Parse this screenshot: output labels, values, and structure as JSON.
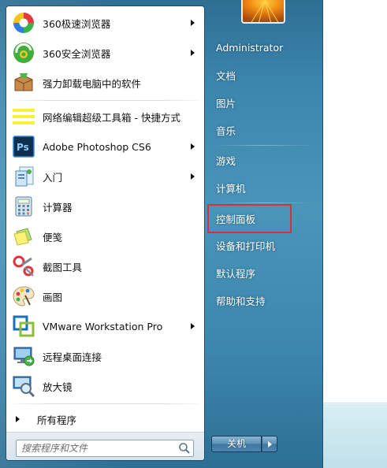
{
  "programs": [
    {
      "label": "360极速浏览器",
      "icon": "360-speed-browser-icon",
      "has_submenu": true
    },
    {
      "label": "360安全浏览器",
      "icon": "360-safe-browser-icon",
      "has_submenu": true
    },
    {
      "label": "强力卸载电脑中的软件",
      "icon": "uninstall-box-icon",
      "has_submenu": false
    },
    {
      "label": "网络编辑超级工具箱 - 快捷方式",
      "icon": "yellow-lines-icon",
      "has_submenu": false
    },
    {
      "label": "Adobe Photoshop CS6",
      "icon": "photoshop-icon",
      "has_submenu": true
    },
    {
      "label": "入门",
      "icon": "getting-started-icon",
      "has_submenu": true
    },
    {
      "label": "计算器",
      "icon": "calculator-icon",
      "has_submenu": false
    },
    {
      "label": "便笺",
      "icon": "sticky-notes-icon",
      "has_submenu": false
    },
    {
      "label": "截图工具",
      "icon": "snipping-tool-icon",
      "has_submenu": false
    },
    {
      "label": "画图",
      "icon": "paint-palette-icon",
      "has_submenu": false
    },
    {
      "label": "VMware Workstation Pro",
      "icon": "vmware-icon",
      "has_submenu": true
    },
    {
      "label": "远程桌面连接",
      "icon": "remote-desktop-icon",
      "has_submenu": false
    },
    {
      "label": "放大镜",
      "icon": "magnifier-icon",
      "has_submenu": false
    }
  ],
  "all_programs_label": "所有程序",
  "search": {
    "placeholder": "搜索程序和文件"
  },
  "right_links": [
    {
      "label": "Administrator"
    },
    {
      "label": "文档"
    },
    {
      "label": "图片"
    },
    {
      "label": "音乐"
    },
    {
      "label": "游戏"
    },
    {
      "label": "计算机"
    },
    {
      "label": "控制面板"
    },
    {
      "label": "设备和打印机"
    },
    {
      "label": "默认程序"
    },
    {
      "label": "帮助和支持"
    }
  ],
  "shutdown_label": "关机",
  "colors": {
    "highlight_border": "#d6313c",
    "menu_blue": "#3c86ad"
  }
}
